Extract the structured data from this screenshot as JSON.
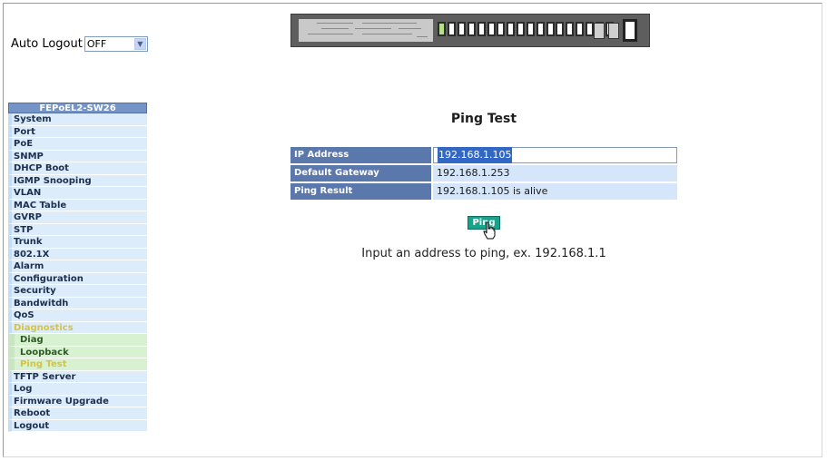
{
  "auto_logout": {
    "label": "Auto Logout",
    "selected": "OFF"
  },
  "sidebar": {
    "title": "FEPoEL2-SW26",
    "items": [
      {
        "label": "System"
      },
      {
        "label": "Port"
      },
      {
        "label": "PoE"
      },
      {
        "label": "SNMP"
      },
      {
        "label": "DHCP Boot"
      },
      {
        "label": "IGMP Snooping"
      },
      {
        "label": "VLAN"
      },
      {
        "label": "MAC Table"
      },
      {
        "label": "GVRP"
      },
      {
        "label": "STP"
      },
      {
        "label": "Trunk"
      },
      {
        "label": "802.1X"
      },
      {
        "label": "Alarm"
      },
      {
        "label": "Configuration"
      },
      {
        "label": "Security"
      },
      {
        "label": "Bandwitdh"
      },
      {
        "label": "QoS"
      },
      {
        "label": "Diagnostics"
      }
    ],
    "sub_items": [
      {
        "label": "Diag"
      },
      {
        "label": "Loopback"
      },
      {
        "label": "Ping Test"
      }
    ],
    "items_after": [
      {
        "label": "TFTP Server"
      },
      {
        "label": "Log"
      },
      {
        "label": "Firmware Upgrade"
      },
      {
        "label": "Reboot"
      },
      {
        "label": "Logout"
      }
    ]
  },
  "main": {
    "title": "Ping Test",
    "rows": [
      {
        "label": "IP Address",
        "value": "192.168.1.105"
      },
      {
        "label": "Default Gateway",
        "value": "192.168.1.253"
      },
      {
        "label": "Ping Result",
        "value": "192.168.1.105 is alive"
      }
    ],
    "button_label": "Ping",
    "hint": "Input an address to ping, ex. 192.168.1.1"
  },
  "colors": {
    "label_bg": "#5b78ad",
    "value_bg": "#d5e6fb",
    "button_bg": "#19a38b",
    "active_nav": "#d6c43a"
  }
}
